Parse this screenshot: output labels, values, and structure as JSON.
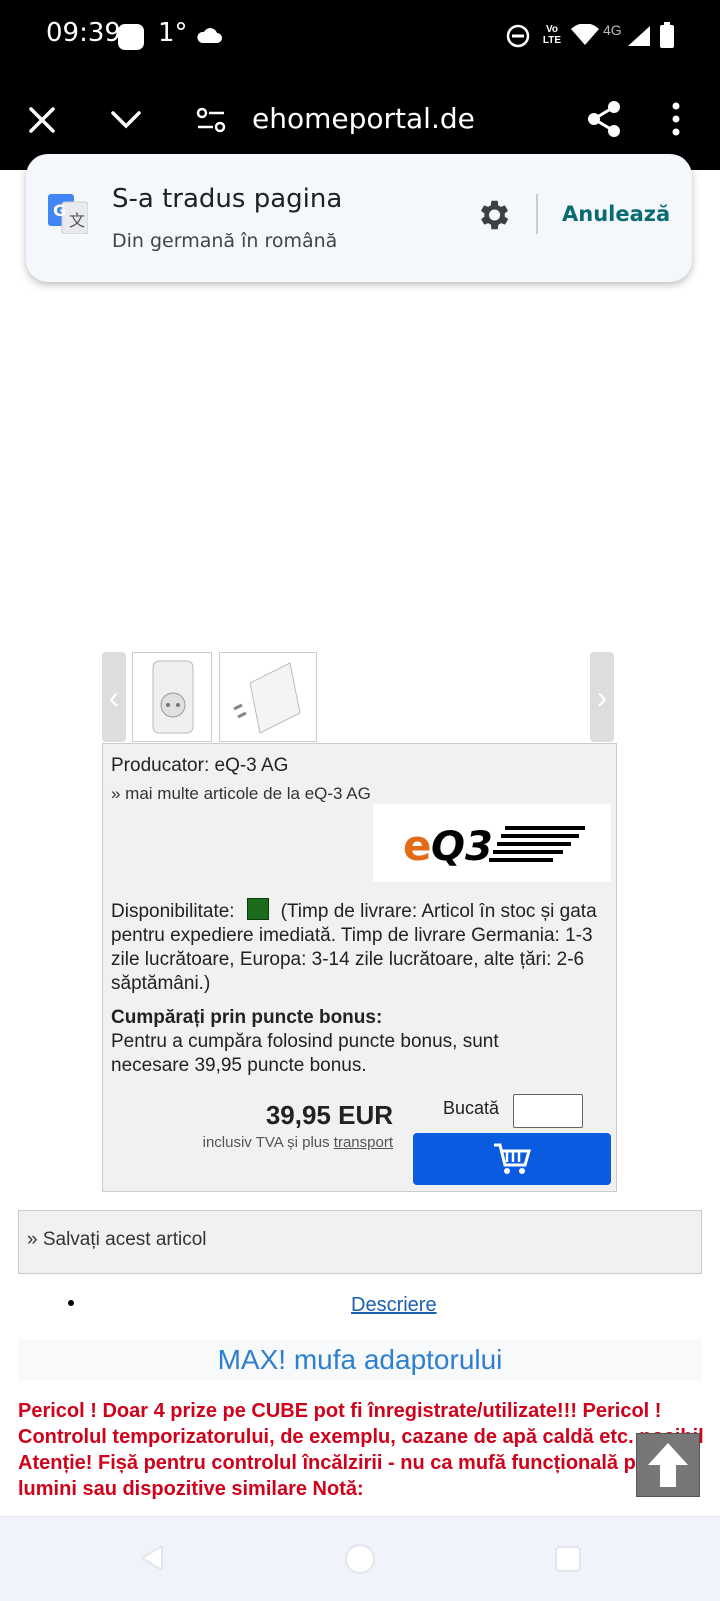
{
  "status_bar": {
    "time": "09:39",
    "temperature": "1°",
    "network": "4G",
    "volte": "Vo LTE"
  },
  "browser": {
    "url": "ehomeportal.de"
  },
  "translate_card": {
    "title": "S-a tradus pagina",
    "subtitle": "Din germană în română",
    "cancel_label": "Anulează",
    "accent_color": "#0b6b73"
  },
  "product": {
    "manufacturer_label": "Producator: eQ-3 AG",
    "more_articles_link": "» mai multe articole de la eQ-3 AG",
    "logo_text": "eQ3",
    "availability_label": "Disponibilitate:",
    "availability_text": "(Timp de livrare: Articol în stoc și gata pentru expediere imediată. Timp de livrare Germania: 1-3 zile lucrătoare, Europa: 3-14 zile lucrătoare, alte țări: 2-6 săptămâni.)",
    "bonus_title": "Cumpărați prin puncte bonus:",
    "bonus_text": "Pentru a cumpăra folosind puncte bonus, sunt necesare 39,95 puncte bonus.",
    "price": "39,95 EUR",
    "vat_text": "inclusiv TVA și plus",
    "shipping_link": "transport",
    "quantity_label": "Bucată",
    "quantity_value": "",
    "stock_color": "#1c6b1c",
    "cart_color": "#0a5be0"
  },
  "save_article": "» Salvați acest articol",
  "description_link": "Descriere",
  "heading": "MAX! mufa adaptorului",
  "warning_text": "Pericol ! Doar 4 prize pe CUBE pot fi înregistrate/utilizate!!!  Pericol ! Controlul temporizatorului, de exemplu, cazane de apă caldă etc. posibil Atenție! Fișă pentru controlul încălzirii - nu ca mufă funcțională pentru lumini sau dispozitive similare Notă:"
}
